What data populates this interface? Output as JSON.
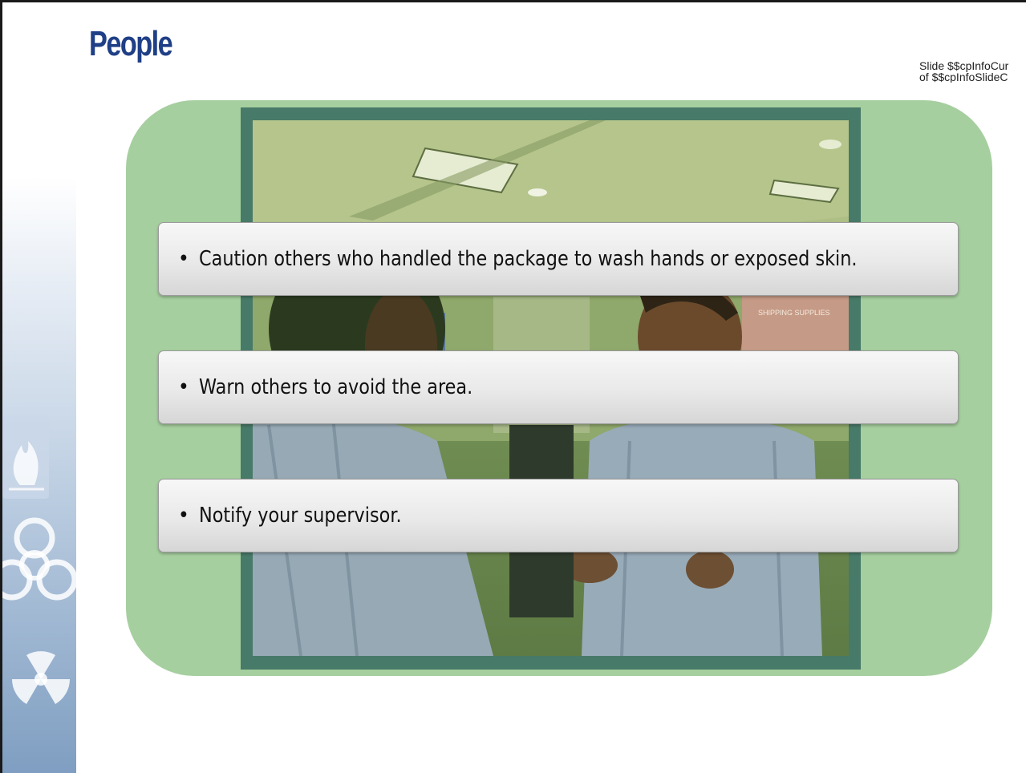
{
  "slide": {
    "title": "People",
    "info_line1": "Slide $$cpInfoCur",
    "info_line2": "of $$cpInfoSlideC"
  },
  "bullets": [
    {
      "marker": "•",
      "text": "Caution others who handled the package to wash hands or exposed skin."
    },
    {
      "marker": "•",
      "text": "Warn others to avoid the area."
    },
    {
      "marker": "•",
      "text": "Notify your supervisor."
    }
  ],
  "photo": {
    "sign_text": "SHIPPING SUPPLIES"
  },
  "sidebar_icons": [
    "flame-icon",
    "biohazard-icon",
    "radiation-icon"
  ],
  "colors": {
    "title": "#1f3f86",
    "panel": "#a6cf9f",
    "frame": "#477a68"
  }
}
